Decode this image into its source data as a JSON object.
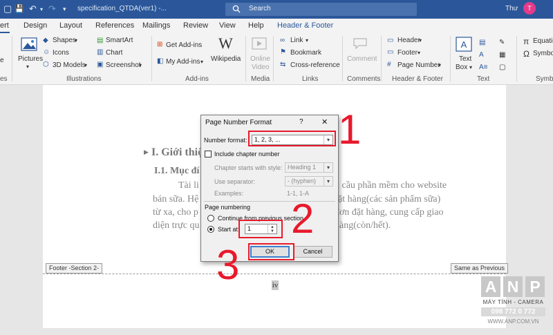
{
  "titlebar": {
    "document_title": "specification_QTDA(ver1)  -...",
    "search_label": "Search",
    "user_name": "Thư",
    "avatar_initial": "T"
  },
  "tabs": [
    "ert",
    "Design",
    "Layout",
    "References",
    "Mailings",
    "Review",
    "View",
    "Help",
    "Header & Footer"
  ],
  "ribbon": {
    "file_partial_label": "e",
    "pictures": "Pictures",
    "shapes": "Shapes",
    "icons": "Icons",
    "models_3d": "3D Models",
    "smartart": "SmartArt",
    "chart": "Chart",
    "screenshot": "Screenshot",
    "get_addins": "Get Add-ins",
    "my_addins": "My Add-ins",
    "wikipedia": "Wikipedia",
    "online_video_1": "Online",
    "online_video_2": "Video",
    "link": "Link",
    "bookmark": "Bookmark",
    "cross_reference": "Cross-reference",
    "comment": "Comment",
    "header": "Header",
    "footer": "Footer",
    "page_number": "Page Number",
    "text_box_1": "Text",
    "text_box_2": "Box",
    "equation": "Equatio",
    "symbol": "Symbo",
    "groups": {
      "partial_left": "es",
      "illustrations": "Illustrations",
      "addins": "Add-ins",
      "media": "Media",
      "links": "Links",
      "comments": "Comments",
      "header_footer": "Header & Footer",
      "text": "Text",
      "symbols": "Symbo"
    }
  },
  "document": {
    "heading1": "I. Giới thiệ",
    "heading2": "I.1. Mục đí",
    "line1_left": "Tài li",
    "line1_right": "u cầu phần mềm cho website",
    "line2_left": "bán sữa. Hệ",
    "line2_right": "đặt hàng(các sản phẩm sữa)",
    "line3_left": "từ xa, cho p",
    "line3_right": "đơn đặt hàng, cung cấp giao",
    "line4_left": "diện trực qu",
    "line4_right": "hàng(còn/hết).",
    "footer_label": "Footer -Section 2-",
    "same_as_previous": "Same as Previous",
    "page_number_value": "iv"
  },
  "dialog": {
    "title": "Page Number Format",
    "help": "?",
    "close": "✕",
    "number_format_label": "Number format:",
    "number_format_value": "1, 2, 3, ...",
    "include_chapter_label": "Include chapter number",
    "chapter_starts_label": "Chapter starts with style:",
    "chapter_starts_value": "Heading 1",
    "use_separator_label": "Use separator:",
    "use_separator_value": "-   (hyphen)",
    "examples_label": "Examples:",
    "examples_value": "1-1, 1-A",
    "page_numbering_label": "Page numbering",
    "continue_label": "Continue from previous section",
    "start_at_label": "Start at:",
    "start_at_value": "1",
    "ok": "OK",
    "cancel": "Cancel"
  },
  "annotations": {
    "step1": "1",
    "step2": "2",
    "step3": "3"
  },
  "watermark": {
    "letters": [
      "A",
      "N",
      "P"
    ],
    "tagline": "MÁY TÍNH - CAMERA",
    "phone": "098 772 0 772",
    "url": "WWW.ANP.COM.VN"
  },
  "colors": {
    "titlebar": "#2b579a",
    "annotation_red": "#e8192c",
    "accent_blue": "#3c7fd0"
  }
}
